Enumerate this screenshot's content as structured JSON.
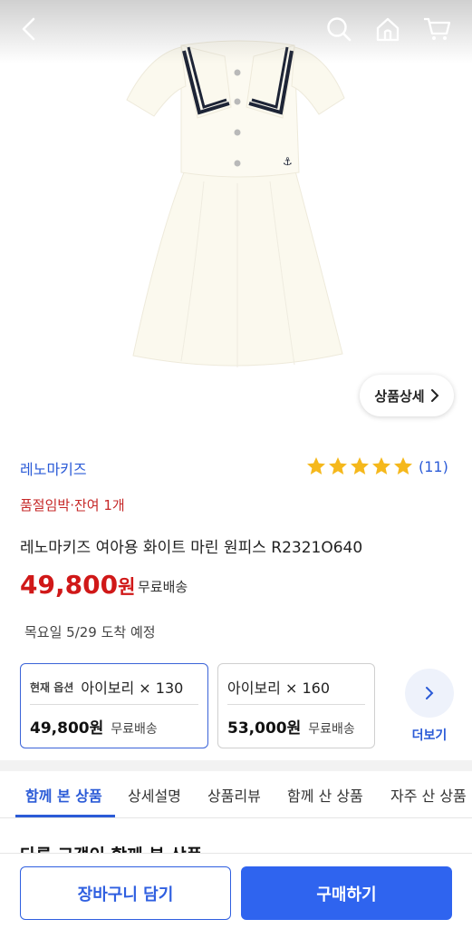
{
  "header": {
    "back_icon": "chevron-left-icon",
    "search_icon": "search-icon",
    "home_icon": "home-icon",
    "cart_icon": "cart-icon"
  },
  "image": {
    "detail_button_label": "상품상세"
  },
  "product": {
    "brand": "레노마키즈",
    "rating_stars": 5,
    "rating_count": "(11)",
    "stock_notice": "품절임박·잔여 1개",
    "title": "레노마키즈 여아용 화이트 마린 원피스 R2321O640",
    "price": "49,800",
    "price_unit": "원",
    "shipping": "무료배송",
    "delivery": "목요일 5/29 도착 예정"
  },
  "options": [
    {
      "badge": "현재 옵션",
      "name": "아이보리 × 130",
      "price": "49,800원",
      "shipping": "무료배송",
      "selected": true
    },
    {
      "badge": "",
      "name": "아이보리 × 160",
      "price": "53,000원",
      "shipping": "무료배송",
      "selected": false
    }
  ],
  "more_label": "더보기",
  "tabs": [
    "함께 본 상품",
    "상세설명",
    "상품리뷰",
    "함께 산 상품",
    "자주 산 상품"
  ],
  "section_title": "다른 고객이 함께 본 상품",
  "bottom": {
    "cart_label": "장바구니 담기",
    "buy_label": "구매하기"
  },
  "colors": {
    "accent": "#2f64ef",
    "price": "#d01818",
    "star": "#f5b81c"
  }
}
